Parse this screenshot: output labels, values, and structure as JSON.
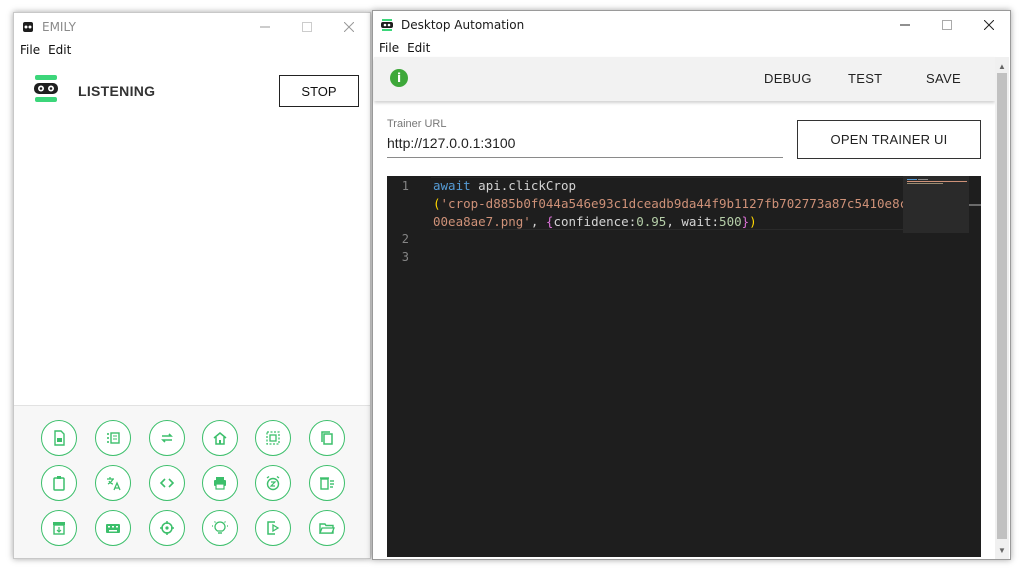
{
  "emily": {
    "title": "EMILY",
    "menu": [
      "File",
      "Edit"
    ],
    "status": "LISTENING",
    "stop_label": "STOP",
    "tools": [
      "file-icon",
      "list-icon",
      "repeat-icon",
      "home-icon",
      "select-icon",
      "copy-icon",
      "clipboard-icon",
      "translate-icon",
      "code-icon",
      "print-icon",
      "alarm-icon",
      "delete-list-icon",
      "archive-icon",
      "keyboard-icon",
      "crosshair-icon",
      "lightbulb-icon",
      "export-icon",
      "folder-open-icon"
    ]
  },
  "automation": {
    "title": "Desktop Automation",
    "menu": [
      "File",
      "Edit"
    ],
    "toolbar": {
      "debug": "DEBUG",
      "test": "TEST",
      "save": "SAVE"
    },
    "trainer_url_label": "Trainer URL",
    "trainer_url": "http://127.0.0.1:3100",
    "open_trainer_label": "OPEN TRAINER UI",
    "editor": {
      "line_numbers": [
        "1",
        "2",
        "3"
      ],
      "code": {
        "await": "await",
        "call": " api.clickCrop",
        "paren_open": "(",
        "string_part1": "'crop-d885b0f044a546e93c1dceadb9da44f9b1127fb702773a87c5410e8c",
        "string_part2": "00ea8ae7.png'",
        "comma": ", ",
        "brace_open": "{",
        "key1": "confidence:",
        "val1": "0.95",
        "sep": ", ",
        "key2": "wait:",
        "val2": "500",
        "brace_close": "}",
        "paren_close": ")"
      }
    }
  },
  "colors": {
    "accent_green": "#3cbf6b",
    "info_green": "#3ea83a",
    "editor_bg": "#1e1e1e"
  }
}
